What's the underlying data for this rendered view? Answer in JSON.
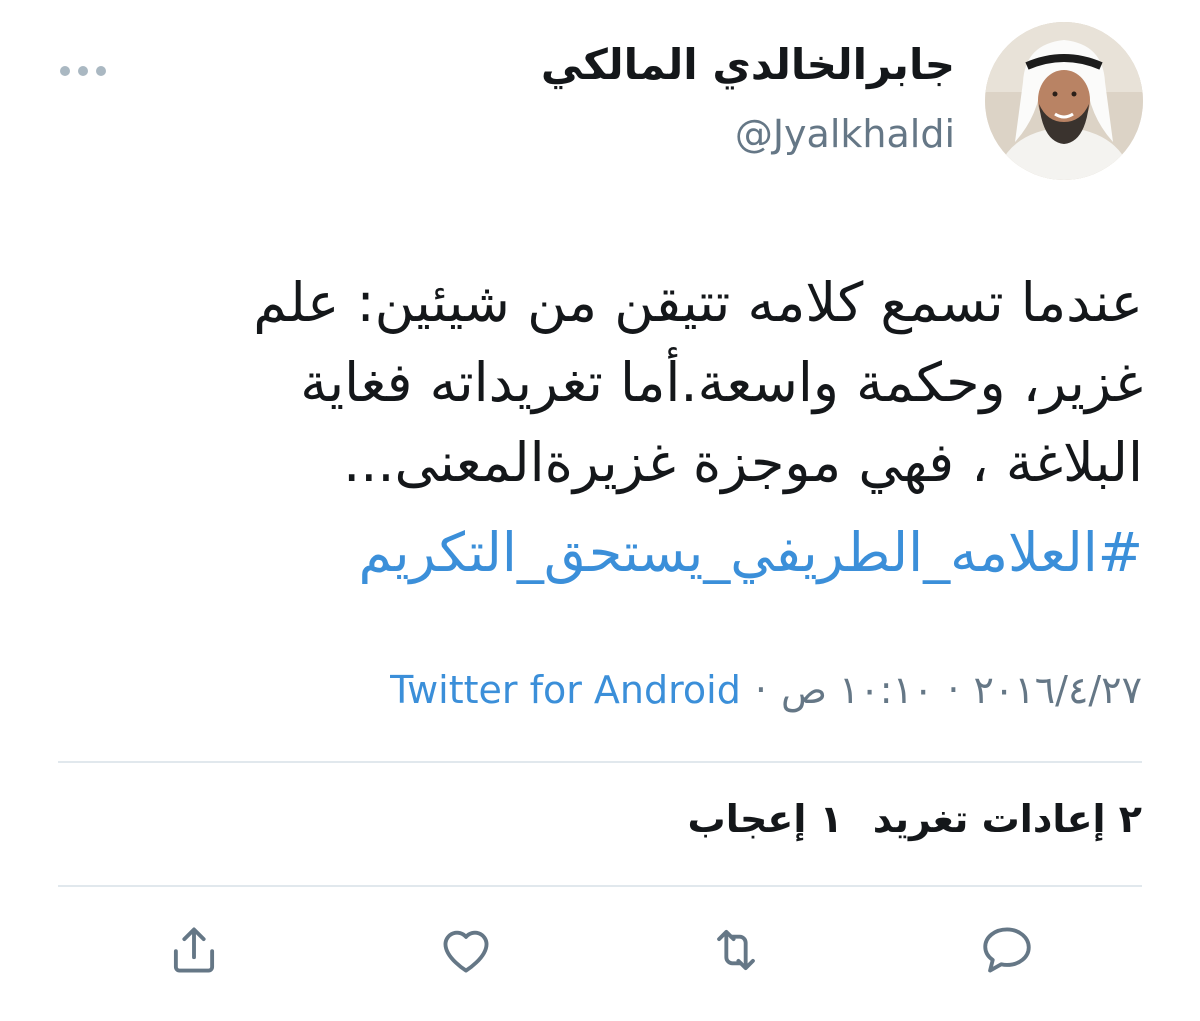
{
  "user": {
    "display_name": "جابرالخالدي المالكي",
    "handle": "@Jyalkhaldi",
    "avatar_icon": "profile-photo"
  },
  "tweet": {
    "lines": [
      "عندما تسمع كلامه تتيقن من شيئين: علم",
      "غزير، وحكمة واسعة.أما تغريداته فغاية",
      "البلاغة ، فهي موجزة غزيرةالمعنى..."
    ],
    "hashtag": "#العلامه_الطريفي_يستحق_التكريم"
  },
  "meta": {
    "date": "٢٠١٦/٤/٢٧",
    "time": "١٠:١٠ ص",
    "separator": "·",
    "source": "Twitter for Android"
  },
  "stats": {
    "retweets": "٢ إعادات تغريد",
    "likes": "١ إعجاب"
  },
  "actions": {
    "reply_icon": "reply-icon",
    "retweet_icon": "retweet-icon",
    "like_icon": "heart-icon",
    "share_icon": "share-icon"
  },
  "colors": {
    "link": "#3b8fd9",
    "secondary": "#657786",
    "icon": "#657786"
  }
}
